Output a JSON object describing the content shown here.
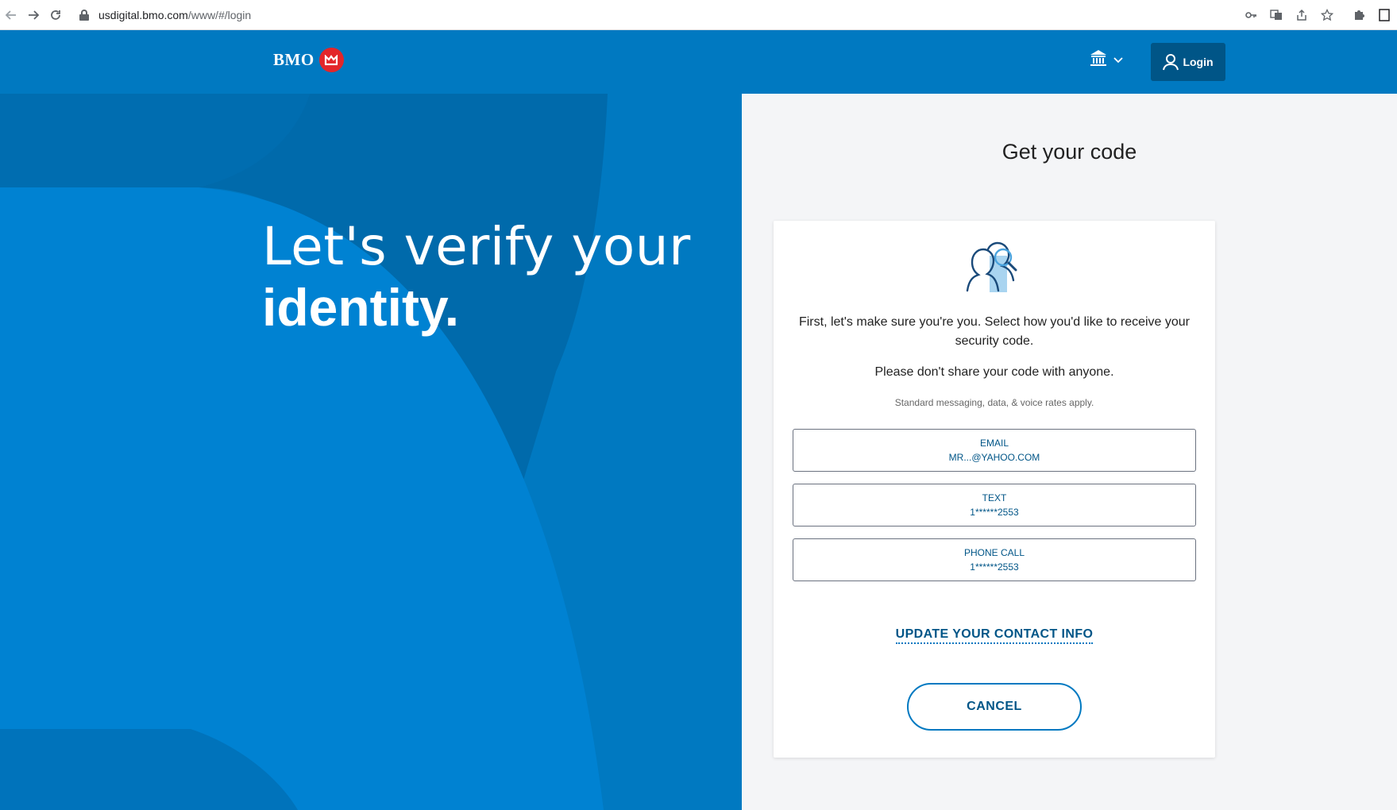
{
  "browser": {
    "url_host": "usdigital.bmo.com",
    "url_path": "/www/#/login",
    "icons": [
      "back-icon",
      "forward-icon",
      "reload-icon",
      "lock-icon",
      "key-icon",
      "translate-icon",
      "share-icon",
      "star-icon",
      "puzzle-icon",
      "window-icon"
    ]
  },
  "header": {
    "logo_text": "BMO",
    "login_label": "Login",
    "accent_color": "#0079c1",
    "login_bg": "#005587",
    "logo_red": "#e3262a"
  },
  "hero": {
    "line1": "Let's verify your",
    "line2": "identity."
  },
  "main": {
    "title": "Get your code",
    "intro": "First, let's make sure you're you. Select how you'd like to receive your security code.",
    "warning": "Please don't share your code with anyone.",
    "rates": "Standard messaging, data, & voice rates apply.",
    "options": [
      {
        "label": "EMAIL",
        "value": "MR...@YAHOO.COM"
      },
      {
        "label": "TEXT",
        "value": "1******2553"
      },
      {
        "label": "PHONE CALL",
        "value": "1******2553"
      }
    ],
    "update_link": "UPDATE YOUR CONTACT INFO",
    "cancel_label": "CANCEL"
  }
}
